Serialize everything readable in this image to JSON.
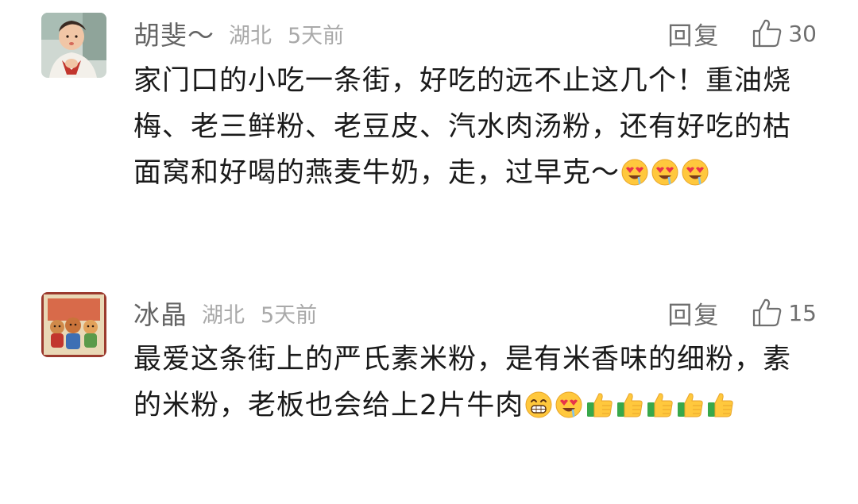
{
  "comments": [
    {
      "username": "胡斐～",
      "location": "湖北",
      "time": "5天前",
      "reply_label": "回复",
      "like_count": "30",
      "text": "家门口的小吃一条街，好吃的远不止这几个！重油烧梅、老三鲜粉、老豆皮、汽水肉汤粉，还有好吃的枯面窝和好喝的燕麦牛奶，走，过早克～",
      "emojis": [
        "heart-eyes-drool",
        "heart-eyes-drool",
        "heart-eyes-drool"
      ]
    },
    {
      "username": "冰晶",
      "location": "湖北",
      "time": "5天前",
      "reply_label": "回复",
      "like_count": "15",
      "text": "最爱这条街上的严氏素米粉，是有米香味的细粉，素的米粉，老板也会给上2片牛肉",
      "emojis": [
        "grin",
        "heart-eyes-drool",
        "thumbs-up",
        "thumbs-up",
        "thumbs-up",
        "thumbs-up",
        "thumbs-up"
      ]
    }
  ],
  "colors": {
    "username": "#646464",
    "meta": "#a9a9a9",
    "body_text": "#1a1a1a",
    "action": "#6f6f6f"
  }
}
